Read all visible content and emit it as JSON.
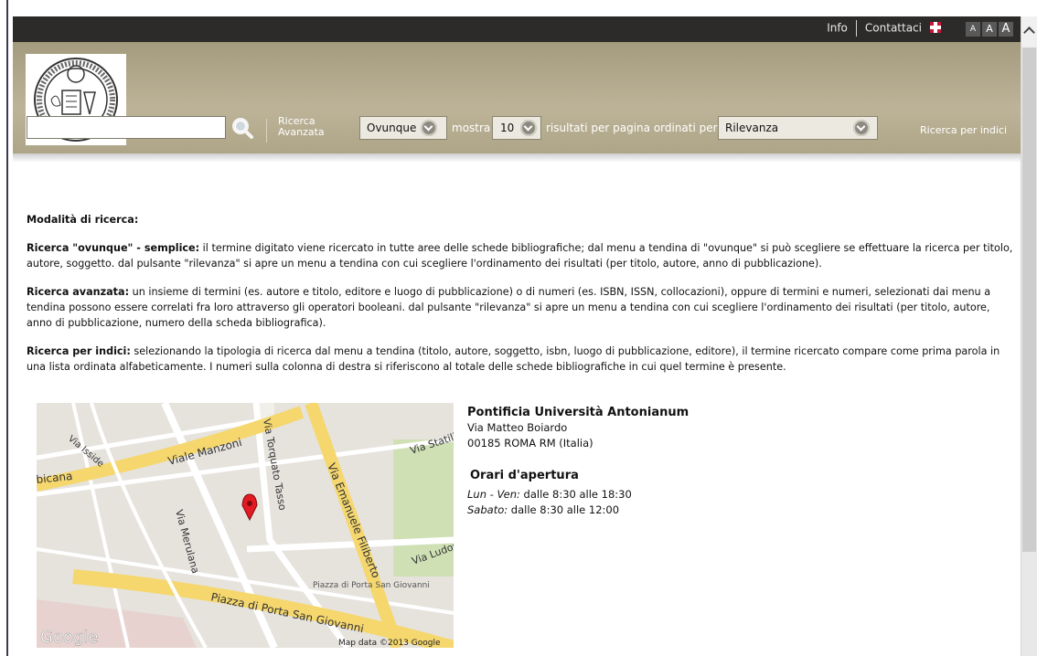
{
  "topbar": {
    "info_link": "Info",
    "contact_link": "Contattaci",
    "font_sizes": [
      "A",
      "A",
      "A"
    ]
  },
  "header": {
    "ricerca_indici": "Ricerca per indici",
    "search_value": "",
    "advanced_line1": "Ricerca",
    "advanced_line2": "Avanzata",
    "scope_select": "Ovunque",
    "mostra_label": "mostra",
    "perpage_select": "10",
    "results_text": "risultati per pagina ordinati per",
    "sort_select": "Rilevanza"
  },
  "content": {
    "heading": "Modalità di ricerca:",
    "sections": [
      {
        "title": "Ricerca \"ovunque\" - semplice:",
        "text": " il termine digitato viene ricercato in tutte aree delle schede bibliografiche; dal menu a tendina di \"ovunque\" si può scegliere se effettuare la ricerca per titolo, autore, soggetto. dal pulsante \"rilevanza\" si apre un menu a tendina con cui scegliere l'ordinamento dei risultati (per titolo, autore, anno di pubblicazione)."
      },
      {
        "title": "Ricerca avanzata:",
        "text": " un insieme di termini (es. autore e titolo, editore e luogo di pubblicazione) o di numeri (es. ISBN, ISSN, collocazioni), oppure di termini e numeri, selezionati dai menu a tendina possono essere correlati fra loro attraverso gli operatori booleani. dal pulsante \"rilevanza\" si apre un menu a tendina con cui scegliere l'ordinamento dei risultati (per titolo, autore, anno di pubblicazione, numero della scheda bibliografica)."
      },
      {
        "title": "Ricerca per indici:",
        "text": " selezionando la tipologia di ricerca dal menu a tendina (titolo, autore, soggetto, isbn, luogo di pubblicazione, editore), il termine ricercato compare come prima parola in una lista ordinata alfabeticamente. I numeri sulla colonna di destra si riferiscono al totale delle schede bibliografiche in cui quel termine è presente."
      }
    ]
  },
  "map": {
    "streets": [
      "Viale Manzoni",
      "Via Torquato Tasso",
      "Via Emanuele Filiberto",
      "Via Merulana",
      "Piazza di Porta San Giovanni",
      "Via Statilia",
      "Via Isside",
      "bicana",
      "Via Ludovico",
      "Piazza di Porta San Giovanni"
    ],
    "watermark": "Google",
    "credit": "Map data ©2013 Google"
  },
  "address": {
    "name": "Pontificia Università Antonianum",
    "street": "Via Matteo Boiardo",
    "city": "00185 ROMA RM (Italia)",
    "hours_title": "Orari d'apertura",
    "weekday_label": "Lun - Ven:",
    "weekday_hours": " dalle 8:30 alle 18:30",
    "saturday_label": "Sabato:",
    "saturday_hours": " dalle 8:30 alle 12:00"
  }
}
